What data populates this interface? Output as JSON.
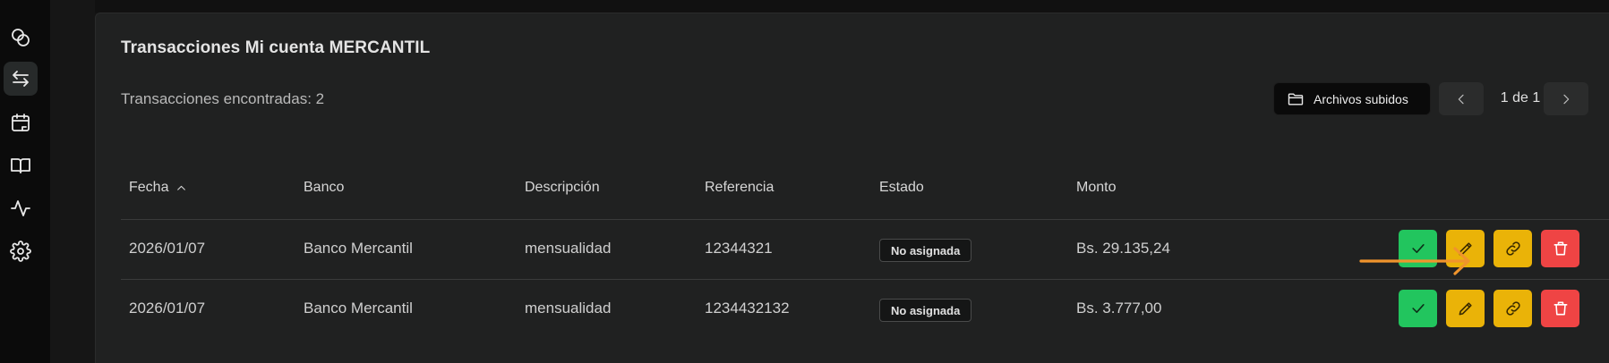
{
  "sidebar": {
    "items": [
      {
        "icon": "coins-icon",
        "active": false
      },
      {
        "icon": "arrows-transfer-icon",
        "active": true
      },
      {
        "icon": "calendar-icon",
        "active": false
      },
      {
        "icon": "book-open-icon",
        "active": false
      },
      {
        "icon": "activity-icon",
        "active": false
      },
      {
        "icon": "settings-icon",
        "active": false
      }
    ]
  },
  "card": {
    "title": "Transacciones Mi cuenta MERCANTIL",
    "count_text": "Transacciones encontradas: 2"
  },
  "toolbar": {
    "files_button_label": "Archivos subidos",
    "files_icon": "folder-icon",
    "prev_icon": "chevron-left-icon",
    "next_icon": "chevron-right-icon",
    "page_indicator": "1 de 1"
  },
  "table": {
    "columns": [
      "Fecha",
      "Banco",
      "Descripción",
      "Referencia",
      "Estado",
      "Monto"
    ],
    "sort_column": "Fecha",
    "sort_direction": "ascending",
    "rows": [
      {
        "fecha": "2026/01/07",
        "banco": "Banco Mercantil",
        "descripcion": "mensualidad",
        "referencia": "12344321",
        "estado": "No asignada",
        "monto": "Bs. 29.135,24"
      },
      {
        "fecha": "2026/01/07",
        "banco": "Banco Mercantil",
        "descripcion": "mensualidad",
        "referencia": "1234432132",
        "estado": "No asignada",
        "monto": "Bs. 3.777,00"
      }
    ],
    "row_actions": [
      "check-icon",
      "pencil-icon",
      "link-icon",
      "trash-icon"
    ]
  },
  "colors": {
    "approve": "#22c55e",
    "edit": "#eab308",
    "link": "#eab308",
    "delete": "#ef4444",
    "annotation_arrow": "#f0942c"
  }
}
